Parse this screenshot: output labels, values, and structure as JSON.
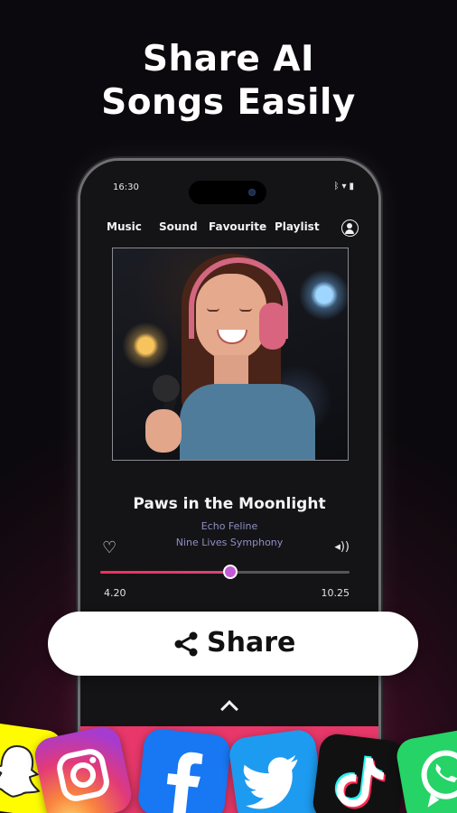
{
  "headline": {
    "line1": "Share AI",
    "line2": "Songs Easily"
  },
  "status_bar": {
    "time": "16:30",
    "icons": [
      "bluetooth-icon",
      "wifi-icon",
      "battery-icon"
    ]
  },
  "nav": {
    "tabs": [
      {
        "label": "Music"
      },
      {
        "label": "Sound"
      },
      {
        "label": "Favourite"
      },
      {
        "label": "Playlist"
      }
    ],
    "profile_icon": "profile-icon"
  },
  "player": {
    "song_title": "Paws in the Moonlight",
    "artist": "Echo Feline",
    "album": "Nine Lives Symphony",
    "current_time": "4.20",
    "total_time": "10.25",
    "progress": 0.52
  },
  "share_button": {
    "label": "Share",
    "icon": "share-icon"
  },
  "apps": [
    "snapchat-icon",
    "instagram-icon",
    "facebook-icon",
    "twitter-icon",
    "tiktok-icon",
    "whatsapp-icon"
  ],
  "colors": {
    "accent": "#e8386a",
    "thumb": "#c45bd6",
    "secondary_text": "#8f8ec4"
  }
}
